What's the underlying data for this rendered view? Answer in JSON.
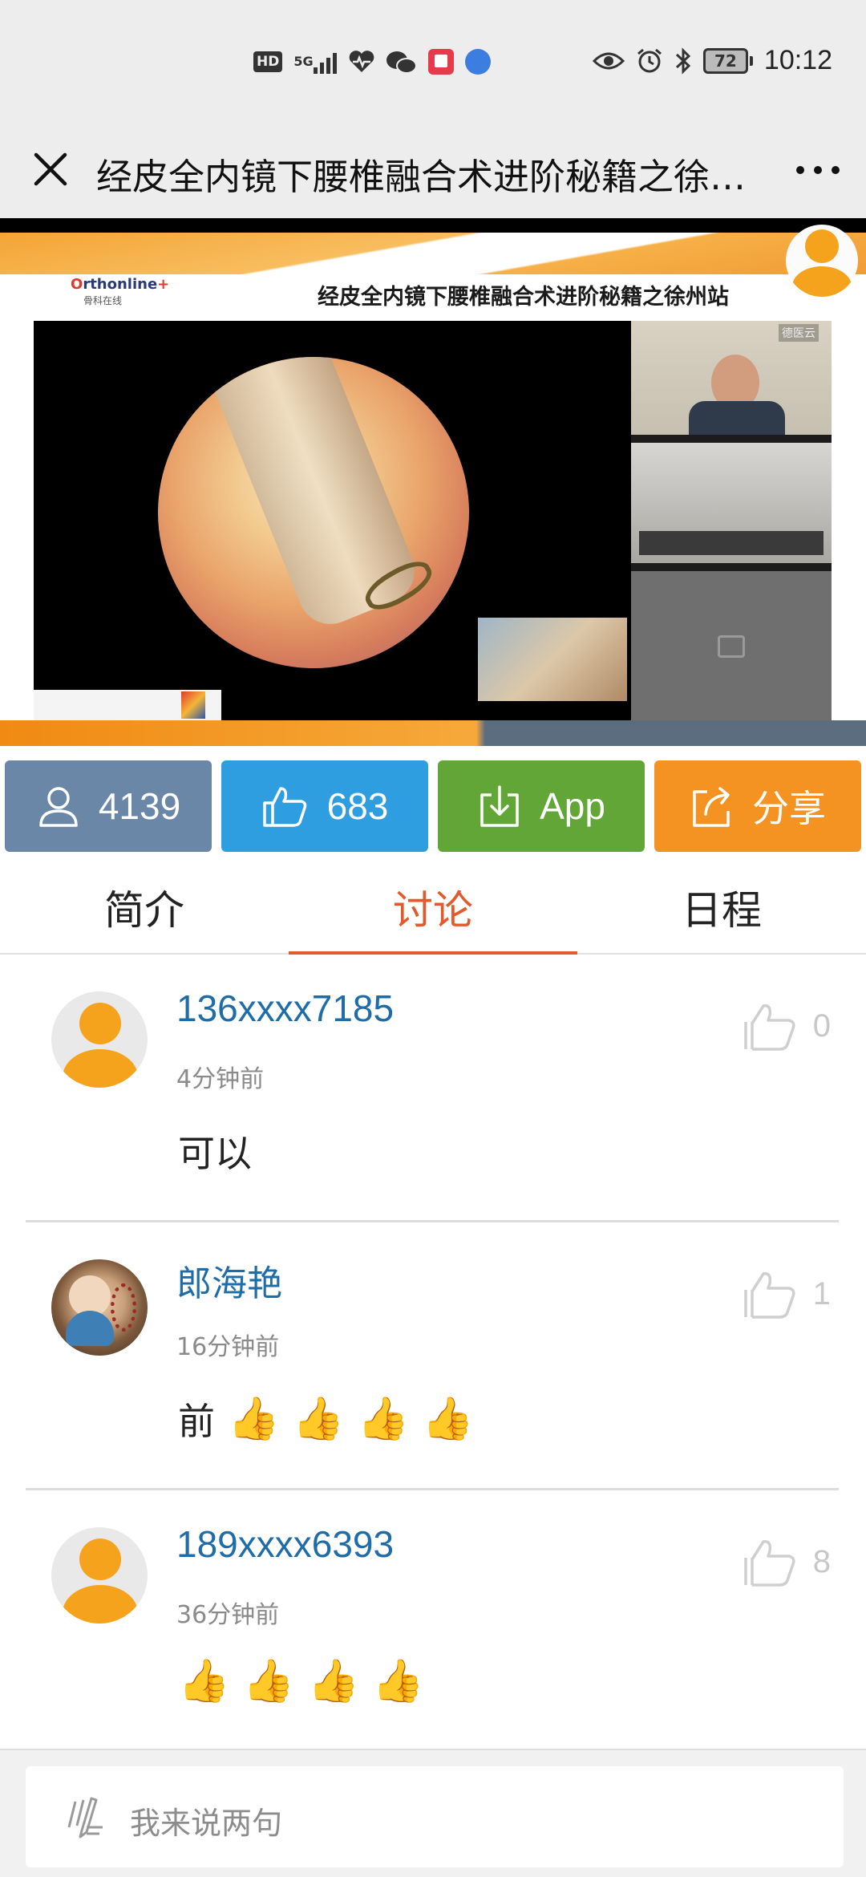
{
  "status_bar": {
    "left_icons": [
      "hd-icon",
      "5g-signal-icon",
      "health-icon",
      "wechat-icon",
      "book-app-icon",
      "browser-icon"
    ],
    "hd_label": "HD",
    "network_label": "5G",
    "right_icons": [
      "eye-icon",
      "alarm-icon",
      "bluetooth-icon",
      "battery-icon"
    ],
    "battery": "72",
    "time": "10:12"
  },
  "title_bar": {
    "title": "经皮全内镜下腰椎融合术进阶秘籍之徐州站",
    "close_icon": "close-icon",
    "more_icon": "more-icon"
  },
  "video": {
    "slide_title": "经皮全内镜下腰椎融合术进阶秘籍之徐州站",
    "logo_text": "rthonline",
    "logo_sub": "骨科在线",
    "cam_label": "德医云"
  },
  "actions": {
    "viewers": "4139",
    "likes": "683",
    "app": "App",
    "share": "分享"
  },
  "tabs": {
    "intro": "简介",
    "discuss": "讨论",
    "schedule": "日程",
    "active": "讨论"
  },
  "comments": [
    {
      "user": "136xxxx7185",
      "time": "4分钟前",
      "text": "可以",
      "emoji_count": 0,
      "likes": "0"
    },
    {
      "user": "郎海艳",
      "time": "16分钟前",
      "text": "前",
      "emoji_count": 4,
      "likes": "1"
    },
    {
      "user": "189xxxx6393",
      "time": "36分钟前",
      "text": "",
      "emoji_count": 4,
      "likes": "8"
    }
  ],
  "input": {
    "placeholder": "我来说两句"
  },
  "colors": {
    "viewers_bg": "#6a87a7",
    "likes_bg": "#2f9ee0",
    "app_bg": "#61a636",
    "share_bg": "#f59322",
    "active_tab": "#e2592b",
    "username": "#1e6ca8",
    "avatar_orange": "#f5a31c"
  }
}
